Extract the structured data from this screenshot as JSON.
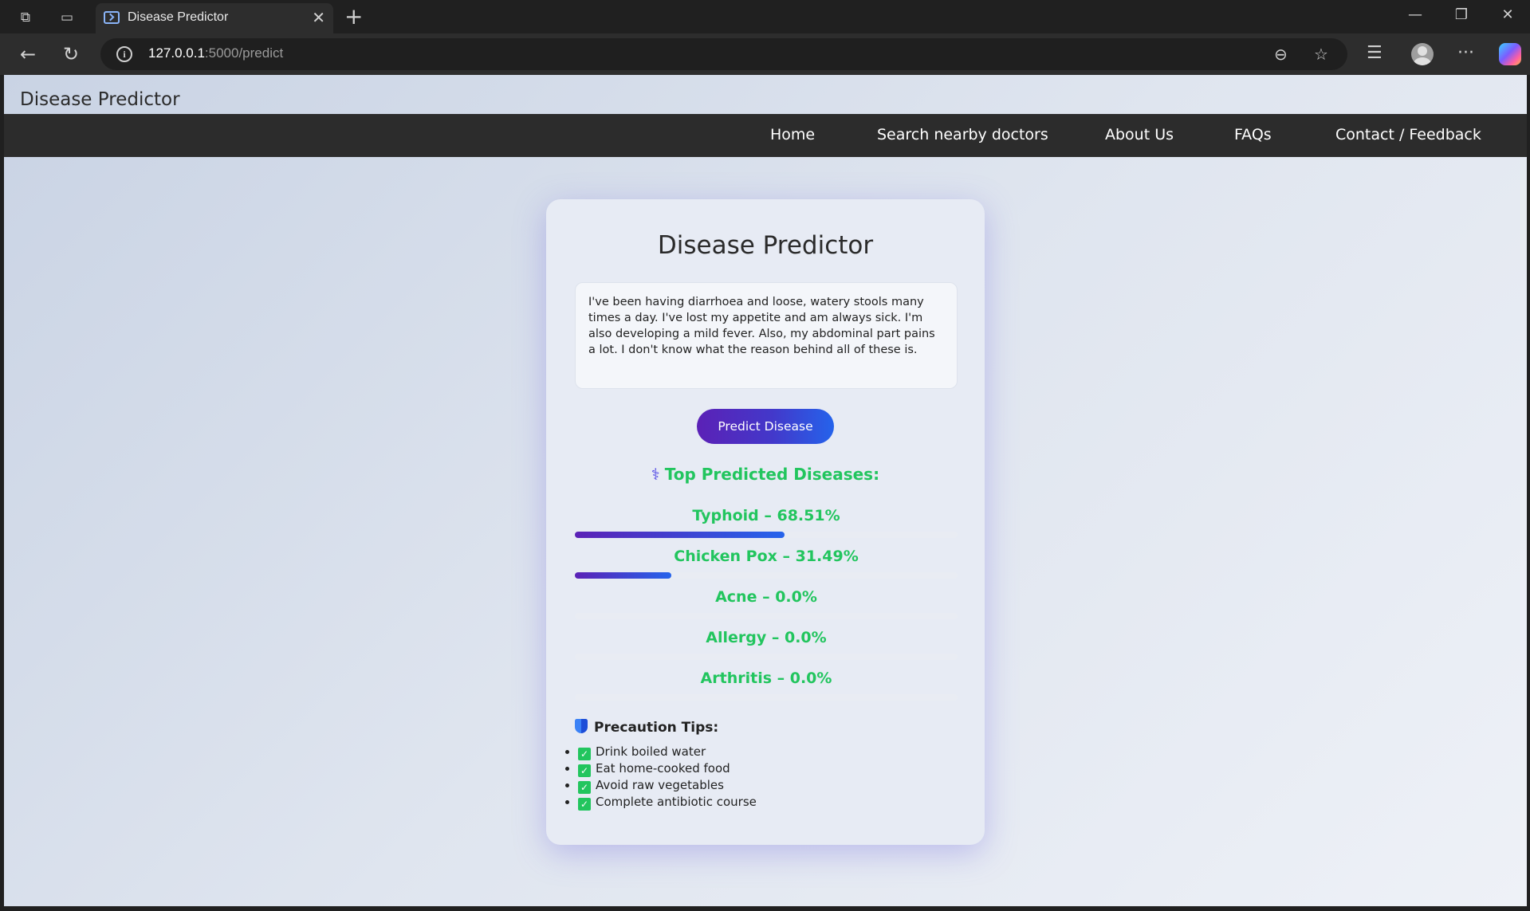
{
  "browser": {
    "tab_title": "Disease Predictor",
    "url_host": "127.0.0.1",
    "url_rest": ":5000/predict"
  },
  "site": {
    "title": "Disease Predictor",
    "nav": [
      "Home",
      "Search nearby doctors",
      "About Us",
      "FAQs",
      "Contact / Feedback"
    ]
  },
  "card": {
    "title": "Disease Predictor",
    "symptoms_text": "I've been having diarrhoea and loose, watery stools many times a day. I've lost my appetite and am always sick. I'm also developing a mild fever. Also, my abdominal part pains a lot. I don't know what the reason behind all of these is.",
    "predict_button": "Predict Disease",
    "results_heading": "Top Predicted Diseases:",
    "results_icon": "stethoscope-icon",
    "predictions": [
      {
        "label": "Typhoid – 68.51%",
        "percent": 68.51
      },
      {
        "label": "Chicken Pox – 31.49%",
        "percent": 31.49
      },
      {
        "label": "Acne – 0.0%",
        "percent": 0.0
      },
      {
        "label": "Allergy – 0.0%",
        "percent": 0.0
      },
      {
        "label": "Arthritis – 0.0%",
        "percent": 0.0
      }
    ],
    "precaution_title": "Precaution Tips:",
    "precaution_icon": "shield-icon",
    "tips": [
      "Drink boiled water",
      "Eat home-cooked food",
      "Avoid raw vegetables",
      "Complete antibiotic course"
    ]
  },
  "colors": {
    "accent_green": "#22c55e",
    "button_gradient_start": "#5b21b6",
    "button_gradient_end": "#2563eb",
    "nav_bg": "#2c2c2c"
  }
}
